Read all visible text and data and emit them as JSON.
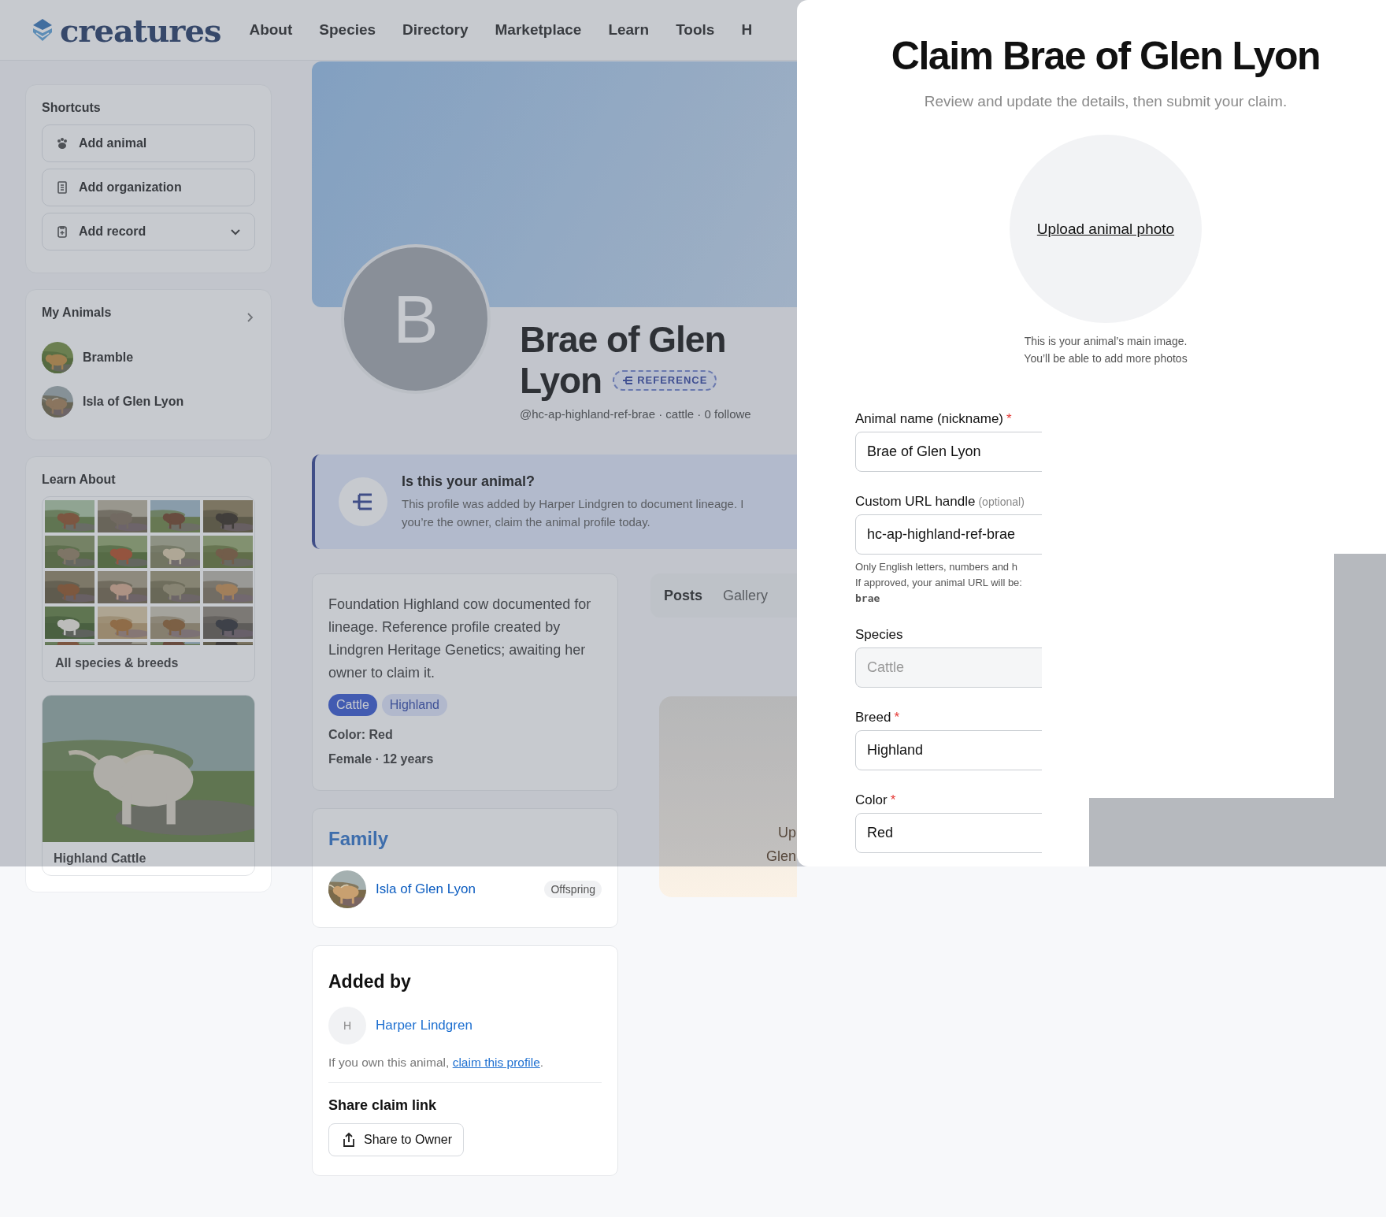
{
  "nav": {
    "logo": "creatures",
    "links": [
      "About",
      "Species",
      "Directory",
      "Marketplace",
      "Learn",
      "Tools",
      "H"
    ]
  },
  "sidebar": {
    "shortcuts": {
      "title": "Shortcuts",
      "items": [
        {
          "label": "Add animal",
          "kind": "animal"
        },
        {
          "label": "Add organization",
          "kind": "organization"
        },
        {
          "label": "Add record",
          "kind": "record-dropdown"
        }
      ]
    },
    "my_animals": {
      "title": "My Animals",
      "items": [
        {
          "name": "Bramble"
        },
        {
          "name": "Isla of Glen Lyon"
        }
      ]
    },
    "learn_about": {
      "title": "Learn About",
      "link": "All species & breeds"
    },
    "feature": {
      "caption": "Highland Cattle"
    }
  },
  "profile": {
    "avatar_letter": "B",
    "name_lines": [
      "Brae of Glen",
      "Lyon"
    ],
    "badge": "REFERENCE",
    "meta": "@hc-ap-highland-ref-brae · cattle · 0 followe"
  },
  "claim_banner": {
    "title": "Is this your animal?",
    "lines": [
      "This profile was added by Harper Lindgren to document lineage. I",
      "you’re the owner, claim the animal profile today."
    ]
  },
  "about": {
    "description": "Foundation Highland cow documented for lineage. Reference profile created by Lindgren Heritage Genetics; awaiting her owner to claim it.",
    "tags": [
      {
        "label": "Cattle",
        "kind": "species"
      },
      {
        "label": "Highland",
        "kind": "breed"
      }
    ],
    "color_line": "Color: Red",
    "summary": "Female · 12 years"
  },
  "family": {
    "title": "Family",
    "members": [
      {
        "name": "Isla of Glen Lyon",
        "relation": "Offspring"
      }
    ]
  },
  "added_by": {
    "title": "Added by",
    "user": {
      "initial": "H",
      "name": "Harper Lindgren"
    },
    "note": "If you own this animal, ",
    "link": "claim this profile",
    "note_end": ".",
    "share_title": "Share claim link",
    "share_button": "Share to Owner"
  },
  "posts": {
    "tabs": [
      {
        "label": "Posts",
        "selected": true
      },
      {
        "label": "Gallery",
        "selected": false
      }
    ],
    "empty_lines": [
      "Up",
      "Glen"
    ]
  },
  "modal": {
    "title": "Claim Brae of Glen Lyon",
    "subtitle": "Review and update the details, then submit your claim.",
    "upload": "Upload animal photo",
    "upload_hint": [
      "This is your animal’s main image.",
      "You’ll be able to add more photos"
    ],
    "fields": [
      {
        "label": "Animal name (nickname)",
        "required_mark": "*",
        "value": "Brae of Glen Lyon",
        "disabled": false
      },
      {
        "label": "Custom URL handle",
        "optional_note": "(optional)",
        "value": "hc-ap-highland-ref-brae",
        "help": [
          "Only English letters, numbers and h",
          "If approved, your animal URL will be:"
        ],
        "help_code": "brae",
        "disabled": false
      },
      {
        "label": "Species",
        "value": "Cattle",
        "disabled": true
      },
      {
        "label": "Breed",
        "required_mark": "*",
        "value": "Highland",
        "disabled": false
      },
      {
        "label": "Color",
        "required_mark": "*",
        "value": "Red",
        "disabled": false
      }
    ]
  }
}
